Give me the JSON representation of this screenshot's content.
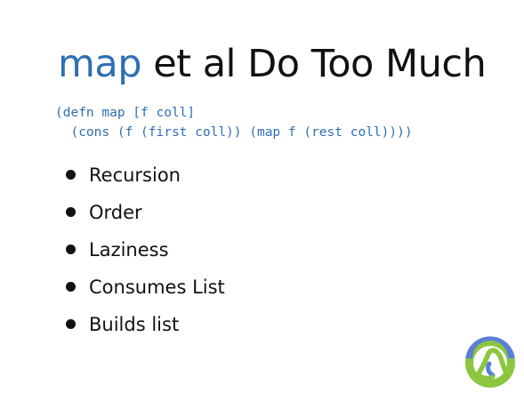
{
  "slide": {
    "title_keyword": "map",
    "title_rest": " et al Do Too Much",
    "code_lines": [
      "(defn map [f coll]",
      "  (cons (f (first coll)) (map f (rest coll))))"
    ],
    "bullets": [
      "Recursion",
      "Order",
      "Laziness",
      "Consumes List",
      "Builds list"
    ]
  },
  "colors": {
    "keyword": "#2f6fb4",
    "text": "#111111",
    "logo_blue": "#5b7fd8",
    "logo_green": "#8cc63f"
  },
  "logo": {
    "icon": "clojure-logo-icon"
  }
}
